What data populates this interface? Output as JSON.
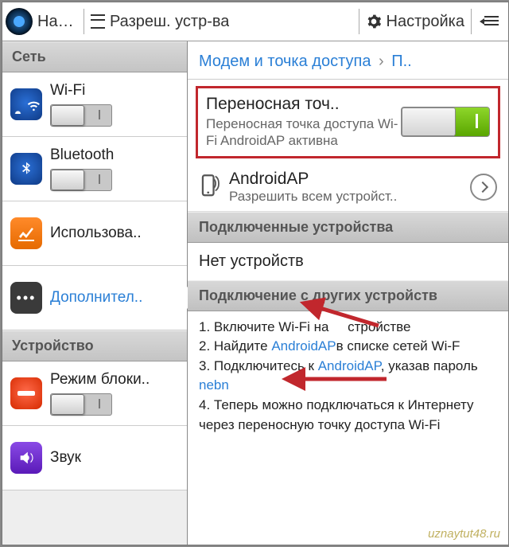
{
  "topbar": {
    "t1": "Наст..",
    "t2": "Разреш. устр-ва",
    "t3": "Настройка"
  },
  "sidebar": {
    "sect_network": "Сеть",
    "sect_device": "Устройство",
    "wifi": "Wi-Fi",
    "bluetooth": "Bluetooth",
    "usage": "Использова..",
    "more": "Дополнител..",
    "lock": "Режим блоки..",
    "sound": "Звук"
  },
  "crumb": {
    "a": "Модем и точка доступа",
    "b": "П.."
  },
  "hotspot": {
    "title": "Переносная точ..",
    "sub": "Переносная точка доступа Wi-Fi AndroidAP активна"
  },
  "ap": {
    "title": "AndroidAP",
    "sub": "Разрешить всем устройст.."
  },
  "hdr_connected": "Подключенные устройства",
  "no_devices": "Нет устройств",
  "hdr_other": "Подключение с других устройств",
  "steps": {
    "s1a": "1. Включите Wi-Fi на",
    "s1b": "стройстве",
    "s2a": "2. Найдите ",
    "s2link": "AndroidAP",
    "s2b": "в списке сетей Wi-F",
    "s3a": "3. Подключитесь к ",
    "s3link": "AndroidAP",
    "s3b": ", указав пароль ",
    "s3pw": "nebn",
    "s4": "4. Теперь можно подключаться к Интернету через переносную точку доступа Wi-Fi"
  },
  "watermark": "uznaytut48.ru"
}
